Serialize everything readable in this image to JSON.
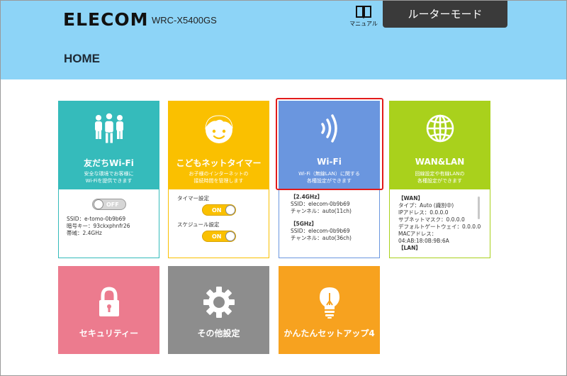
{
  "header": {
    "logo": "ELECOM",
    "model": "WRC-X5400GS",
    "manual_label": "マニュアル",
    "mode_button": "ルーターモード",
    "page_title": "HOME"
  },
  "colors": {
    "header_bg": "#8dd4f7",
    "friends": "#35bbbb",
    "kids": "#fac000",
    "wifi": "#6a96df",
    "wan": "#a9d11c",
    "security": "#ec7b8e",
    "other": "#8d8d8d",
    "setup": "#f7a21f",
    "highlight": "#e21a1a"
  },
  "tiles": {
    "friends": {
      "icon": "people-group-icon",
      "title": "友だちWi-Fi",
      "desc1": "安全な環境でお客様に",
      "desc2": "Wi-Fiを提供できます",
      "toggle": "OFF",
      "ssid": "SSID：e-tomo-0b9b69",
      "key": "暗号キー：93ckxphnfr26",
      "band": "帯域：2.4GHz"
    },
    "kids": {
      "icon": "child-face-icon",
      "title": "こどもネットタイマー",
      "desc1": "お子様のインターネットの",
      "desc2": "接続時間を管理します",
      "timer_label": "タイマー設定",
      "timer_toggle": "ON",
      "schedule_label": "スケジュール設定",
      "schedule_toggle": "ON"
    },
    "wifi": {
      "icon": "wifi-signal-icon",
      "title": "Wi-Fi",
      "desc1": "Wi-Fi（無線LAN）に関する",
      "desc2": "各種設定ができます",
      "band1_header": "【2.4GHz】",
      "band1_ssid": "SSID：elecom-0b9b69",
      "band1_channel": "チャンネル：auto(11ch)",
      "band2_header": "【5GHz】",
      "band2_ssid": "SSID：elecom-0b9b69",
      "band2_channel": "チャンネル：auto(36ch)"
    },
    "wan": {
      "icon": "globe-icon",
      "title": "WAN&LAN",
      "desc1": "回線設定や有線LANの",
      "desc2": "各種設定ができます",
      "header": "【WAN】",
      "type": "タイプ：Auto (識別中)",
      "ip": "IPアドレス：0.0.0.0",
      "subnet": "サブネットマスク：0.0.0.0",
      "gateway": "デフォルトゲートウェイ：0.0.0.0",
      "mac_label": "MACアドレス：",
      "mac": "04:AB:18:0B:9B:6A",
      "lan_header": "【LAN】"
    },
    "security": {
      "icon": "padlock-icon",
      "title": "セキュリティー"
    },
    "other": {
      "icon": "gear-icon",
      "title": "その他設定"
    },
    "setup": {
      "icon": "lightbulb-icon",
      "title": "かんたんセットアップ4"
    }
  }
}
